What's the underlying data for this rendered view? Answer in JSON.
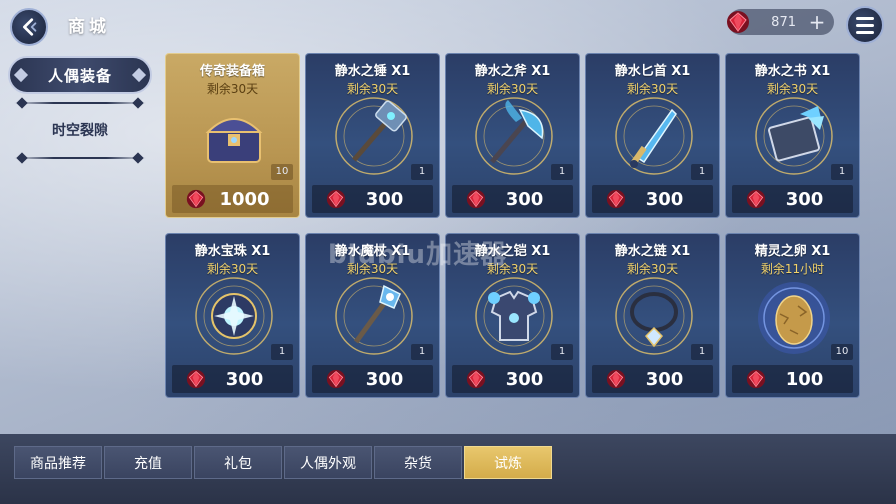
{
  "header": {
    "title": "商城",
    "currency_amount": "871"
  },
  "sidebar": {
    "active_label": "人偶装备",
    "items": [
      "时空裂隙"
    ]
  },
  "items": [
    {
      "name": "传奇装备箱",
      "timer": "剩余30天",
      "qty": "10",
      "price": "1000",
      "art": "chest",
      "gold": true
    },
    {
      "name": "静水之锤 X1",
      "timer": "剩余30天",
      "qty": "1",
      "price": "300",
      "art": "hammer"
    },
    {
      "name": "静水之斧 X1",
      "timer": "剩余30天",
      "qty": "1",
      "price": "300",
      "art": "axe"
    },
    {
      "name": "静水匕首 X1",
      "timer": "剩余30天",
      "qty": "1",
      "price": "300",
      "art": "dagger"
    },
    {
      "name": "静水之书 X1",
      "timer": "剩余30天",
      "qty": "1",
      "price": "300",
      "art": "book"
    },
    {
      "name": "静水宝珠 X1",
      "timer": "剩余30天",
      "qty": "1",
      "price": "300",
      "art": "orb"
    },
    {
      "name": "静水魔杖 X1",
      "timer": "剩余30天",
      "qty": "1",
      "price": "300",
      "art": "wand"
    },
    {
      "name": "静水之铠 X1",
      "timer": "剩余30天",
      "qty": "1",
      "price": "300",
      "art": "armor"
    },
    {
      "name": "静水之链 X1",
      "timer": "剩余30天",
      "qty": "1",
      "price": "300",
      "art": "necklace"
    },
    {
      "name": "精灵之卵 X1",
      "timer": "剩余11小时",
      "qty": "10",
      "price": "100",
      "art": "egg"
    }
  ],
  "tabs": [
    {
      "label": "商品推荐"
    },
    {
      "label": "充值"
    },
    {
      "label": "礼包"
    },
    {
      "label": "人偶外观"
    },
    {
      "label": "杂货"
    },
    {
      "label": "试炼",
      "active": true
    }
  ],
  "watermark": "biubiu加速器",
  "colors": {
    "accent_gold": "#d4ac4a",
    "timer_yellow": "#f2d36b",
    "card_blue": "#34507e",
    "gem_red": "#d8243a"
  }
}
